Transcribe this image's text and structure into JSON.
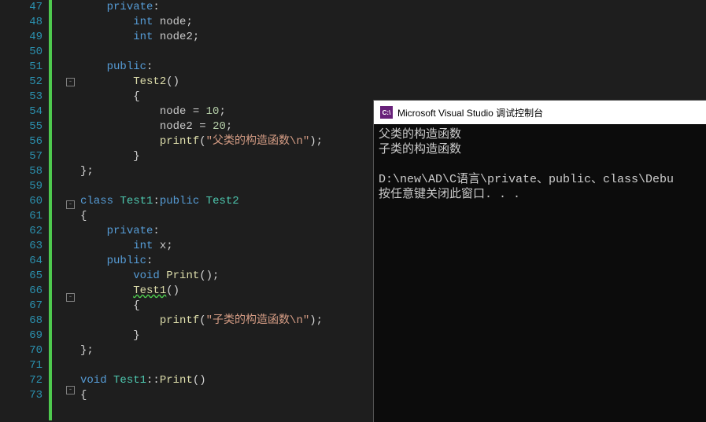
{
  "editor": {
    "line_start": 47,
    "line_end": 73,
    "fold_boxes": {
      "52": "-",
      "60": "-",
      "66": "-",
      "72": "-"
    },
    "lines": [
      {
        "n": 47,
        "seg": [
          {
            "t": "    ",
            "c": "guide"
          },
          {
            "t": "private",
            "c": "kw"
          },
          {
            "t": ":",
            "c": "punct"
          }
        ]
      },
      {
        "n": 48,
        "seg": [
          {
            "t": "        ",
            "c": "guide"
          },
          {
            "t": "int",
            "c": "kw"
          },
          {
            "t": " ",
            "c": ""
          },
          {
            "t": "node",
            "c": "ident"
          },
          {
            "t": ";",
            "c": "punct"
          }
        ]
      },
      {
        "n": 49,
        "seg": [
          {
            "t": "        ",
            "c": "guide"
          },
          {
            "t": "int",
            "c": "kw"
          },
          {
            "t": " ",
            "c": ""
          },
          {
            "t": "node2",
            "c": "ident"
          },
          {
            "t": ";",
            "c": "punct"
          }
        ]
      },
      {
        "n": 50,
        "seg": []
      },
      {
        "n": 51,
        "seg": [
          {
            "t": "    ",
            "c": "guide"
          },
          {
            "t": "public",
            "c": "kw"
          },
          {
            "t": ":",
            "c": "punct"
          }
        ]
      },
      {
        "n": 52,
        "seg": [
          {
            "t": "        ",
            "c": "guide"
          },
          {
            "t": "Test2",
            "c": "func"
          },
          {
            "t": "()",
            "c": "punct"
          }
        ]
      },
      {
        "n": 53,
        "seg": [
          {
            "t": "        ",
            "c": "guide"
          },
          {
            "t": "{",
            "c": "punct"
          }
        ]
      },
      {
        "n": 54,
        "seg": [
          {
            "t": "            ",
            "c": "guide"
          },
          {
            "t": "node",
            "c": "ident"
          },
          {
            "t": " = ",
            "c": "punct"
          },
          {
            "t": "10",
            "c": "num"
          },
          {
            "t": ";",
            "c": "punct"
          }
        ]
      },
      {
        "n": 55,
        "seg": [
          {
            "t": "            ",
            "c": "guide"
          },
          {
            "t": "node2",
            "c": "ident"
          },
          {
            "t": " = ",
            "c": "punct"
          },
          {
            "t": "20",
            "c": "num"
          },
          {
            "t": ";",
            "c": "punct"
          }
        ]
      },
      {
        "n": 56,
        "seg": [
          {
            "t": "            ",
            "c": "guide"
          },
          {
            "t": "printf",
            "c": "func"
          },
          {
            "t": "(",
            "c": "punct"
          },
          {
            "t": "\"父类的构造函数\\n\"",
            "c": "str"
          },
          {
            "t": ");",
            "c": "punct"
          }
        ]
      },
      {
        "n": 57,
        "seg": [
          {
            "t": "        ",
            "c": "guide"
          },
          {
            "t": "}",
            "c": "punct"
          }
        ]
      },
      {
        "n": 58,
        "seg": [
          {
            "t": "};",
            "c": "punct"
          }
        ]
      },
      {
        "n": 59,
        "seg": []
      },
      {
        "n": 60,
        "seg": [
          {
            "t": "class",
            "c": "kw"
          },
          {
            "t": " ",
            "c": ""
          },
          {
            "t": "Test1",
            "c": "type"
          },
          {
            "t": ":",
            "c": "punct"
          },
          {
            "t": "public",
            "c": "kw"
          },
          {
            "t": " ",
            "c": ""
          },
          {
            "t": "Test2",
            "c": "type"
          }
        ]
      },
      {
        "n": 61,
        "seg": [
          {
            "t": "{",
            "c": "punct"
          }
        ]
      },
      {
        "n": 62,
        "seg": [
          {
            "t": "    ",
            "c": "guide"
          },
          {
            "t": "private",
            "c": "kw"
          },
          {
            "t": ":",
            "c": "punct"
          }
        ]
      },
      {
        "n": 63,
        "seg": [
          {
            "t": "        ",
            "c": "guide"
          },
          {
            "t": "int",
            "c": "kw"
          },
          {
            "t": " ",
            "c": ""
          },
          {
            "t": "x",
            "c": "ident"
          },
          {
            "t": ";",
            "c": "punct"
          }
        ]
      },
      {
        "n": 64,
        "seg": [
          {
            "t": "    ",
            "c": "guide"
          },
          {
            "t": "public",
            "c": "kw"
          },
          {
            "t": ":",
            "c": "punct"
          }
        ]
      },
      {
        "n": 65,
        "seg": [
          {
            "t": "        ",
            "c": "guide"
          },
          {
            "t": "void",
            "c": "kw"
          },
          {
            "t": " ",
            "c": ""
          },
          {
            "t": "Print",
            "c": "func"
          },
          {
            "t": "();",
            "c": "punct"
          }
        ]
      },
      {
        "n": 66,
        "seg": [
          {
            "t": "        ",
            "c": "guide"
          },
          {
            "t": "Test1",
            "c": "func squiggle"
          },
          {
            "t": "()",
            "c": "punct"
          }
        ]
      },
      {
        "n": 67,
        "seg": [
          {
            "t": "        ",
            "c": "guide"
          },
          {
            "t": "{",
            "c": "punct"
          }
        ]
      },
      {
        "n": 68,
        "seg": [
          {
            "t": "            ",
            "c": "guide"
          },
          {
            "t": "printf",
            "c": "func"
          },
          {
            "t": "(",
            "c": "punct"
          },
          {
            "t": "\"子类的构造函数\\n\"",
            "c": "str"
          },
          {
            "t": ");",
            "c": "punct"
          }
        ]
      },
      {
        "n": 69,
        "seg": [
          {
            "t": "        ",
            "c": "guide"
          },
          {
            "t": "}",
            "c": "punct"
          }
        ]
      },
      {
        "n": 70,
        "seg": [
          {
            "t": "};",
            "c": "punct"
          }
        ]
      },
      {
        "n": 71,
        "seg": []
      },
      {
        "n": 72,
        "seg": [
          {
            "t": "void",
            "c": "kw"
          },
          {
            "t": " ",
            "c": ""
          },
          {
            "t": "Test1",
            "c": "type"
          },
          {
            "t": "::",
            "c": "punct"
          },
          {
            "t": "Print",
            "c": "func"
          },
          {
            "t": "()",
            "c": "punct"
          }
        ]
      },
      {
        "n": 73,
        "seg": [
          {
            "t": "{",
            "c": "punct"
          }
        ]
      }
    ]
  },
  "console": {
    "title": "Microsoft Visual Studio 调试控制台",
    "icon_text": "C:\\",
    "output": [
      "父类的构造函数",
      "子类的构造函数",
      "",
      "D:\\new\\AD\\C语言\\private、public、class\\Debu",
      "按任意键关闭此窗口. . ."
    ]
  }
}
